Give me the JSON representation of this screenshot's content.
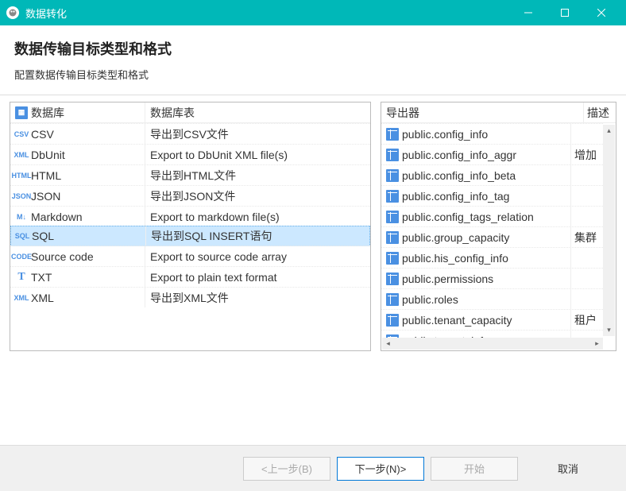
{
  "window": {
    "title": "数据转化"
  },
  "header": {
    "title": "数据传输目标类型和格式",
    "subtitle": "配置数据传输目标类型和格式"
  },
  "left_pane": {
    "col1": "数据库",
    "col2": "数据库表",
    "rows": [
      {
        "icon": "csv",
        "name": "CSV",
        "desc": "导出到CSV文件",
        "selected": false
      },
      {
        "icon": "xml",
        "name": "DbUnit",
        "desc": "Export to DbUnit XML file(s)",
        "selected": false
      },
      {
        "icon": "html",
        "name": "HTML",
        "desc": "导出到HTML文件",
        "selected": false
      },
      {
        "icon": "json",
        "name": "JSON",
        "desc": "导出到JSON文件",
        "selected": false
      },
      {
        "icon": "md",
        "name": "Markdown",
        "desc": "Export to markdown file(s)",
        "selected": false
      },
      {
        "icon": "sql",
        "name": "SQL",
        "desc": "导出到SQL INSERT语句",
        "selected": true
      },
      {
        "icon": "code",
        "name": "Source code",
        "desc": "Export to source code array",
        "selected": false
      },
      {
        "icon": "txt",
        "name": "TXT",
        "desc": "Export to plain text format",
        "selected": false
      },
      {
        "icon": "xml",
        "name": "XML",
        "desc": "导出到XML文件",
        "selected": false
      }
    ]
  },
  "right_pane": {
    "col1": "导出器",
    "col2": "描述",
    "rows": [
      {
        "name": "public.config_info",
        "desc": ""
      },
      {
        "name": "public.config_info_aggr",
        "desc": "增加"
      },
      {
        "name": "public.config_info_beta",
        "desc": ""
      },
      {
        "name": "public.config_info_tag",
        "desc": ""
      },
      {
        "name": "public.config_tags_relation",
        "desc": ""
      },
      {
        "name": "public.group_capacity",
        "desc": "集群"
      },
      {
        "name": "public.his_config_info",
        "desc": ""
      },
      {
        "name": "public.permissions",
        "desc": ""
      },
      {
        "name": "public.roles",
        "desc": ""
      },
      {
        "name": "public.tenant_capacity",
        "desc": "租户"
      },
      {
        "name": "public.tenant_info",
        "desc": ""
      }
    ]
  },
  "footer": {
    "back": "<上一步(B)",
    "next": "下一步(N)>",
    "start": "开始",
    "cancel": "取消"
  },
  "icons": {
    "csv": "CSV",
    "xml": "XML",
    "html": "HTML",
    "json": "JSON",
    "md": "M↓",
    "sql": "SQL",
    "code": "CODE",
    "txt": "T"
  }
}
